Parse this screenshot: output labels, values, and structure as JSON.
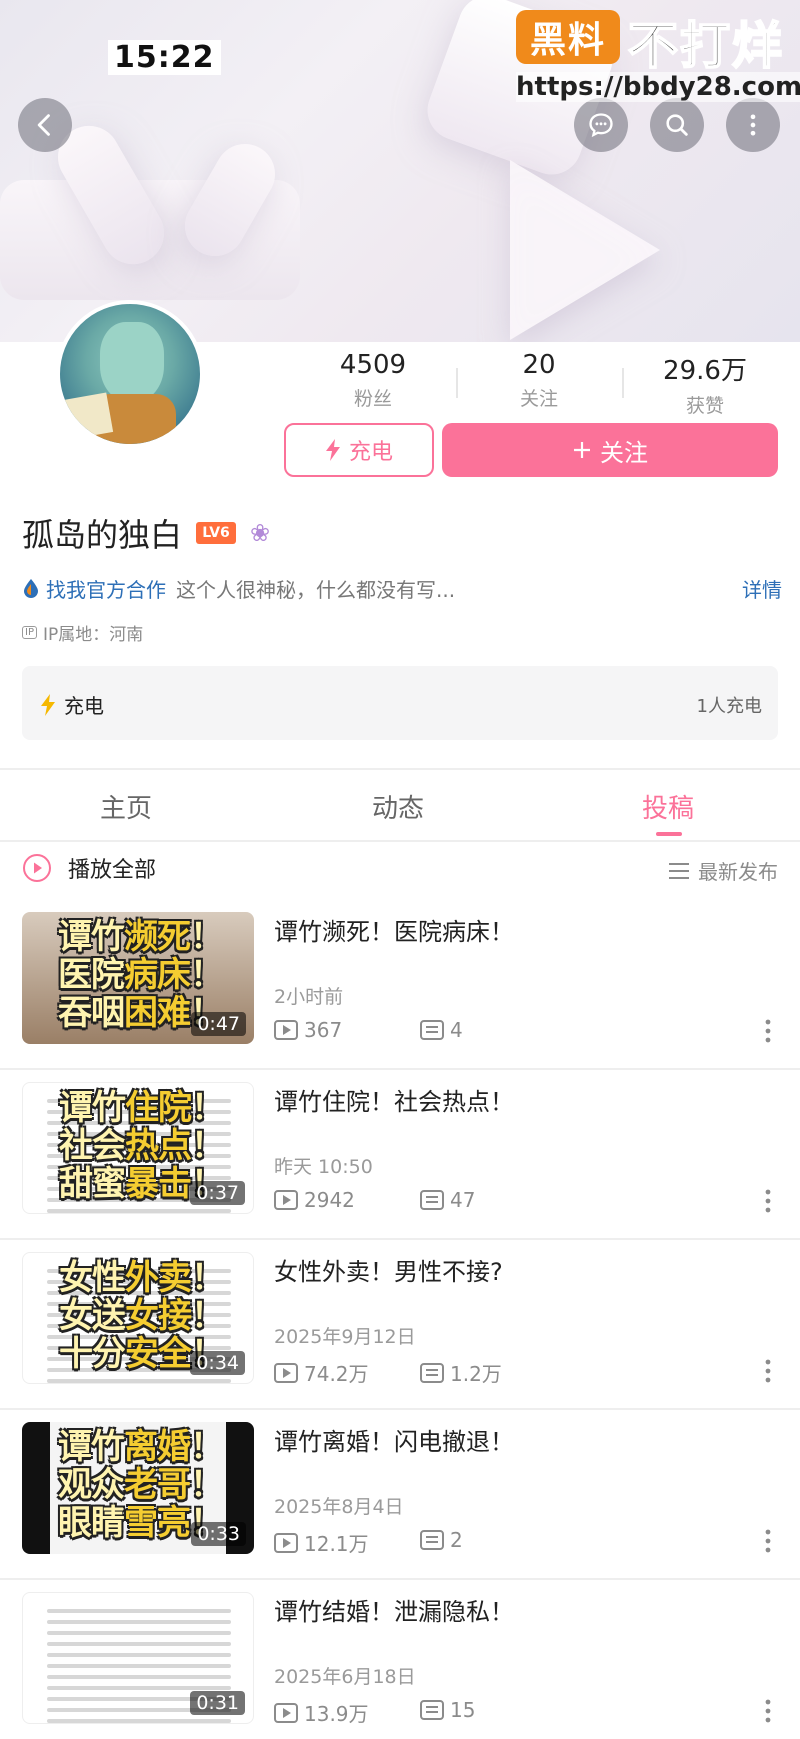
{
  "status": {
    "time": "15:22"
  },
  "watermark": {
    "logo": "黑料",
    "title": "不打烊",
    "url": "https://bbdy28.com"
  },
  "header": {
    "icons": [
      "chevron-left-icon",
      "message-icon",
      "search-icon",
      "more-vertical-icon"
    ]
  },
  "profile": {
    "stats": [
      {
        "value": "4509",
        "label": "粉丝"
      },
      {
        "value": "20",
        "label": "关注"
      },
      {
        "value": "29.6万",
        "label": "获赞"
      }
    ],
    "charge_button": "充电",
    "follow_button": "关注",
    "username": "孤岛的独白",
    "level": "LV6",
    "cooperation": "找我官方合作",
    "bio": "这个人很神秘，什么都没有写...",
    "details_link": "详情",
    "ip_badge": "IP",
    "ip_location": "IP属地：河南",
    "charge_card": {
      "label": "充电",
      "count": "1人充电"
    }
  },
  "tabs": [
    {
      "label": "主页",
      "active": false
    },
    {
      "label": "动态",
      "active": false
    },
    {
      "label": "投稿",
      "active": true
    }
  ],
  "list_header": {
    "play_all": "播放全部",
    "sort": "最新发布"
  },
  "videos": [
    {
      "cover": [
        "谭竹",
        "濒死",
        "！",
        "医院",
        "病床",
        "！",
        "吞咽",
        "困难",
        "！"
      ],
      "duration": "0:47",
      "title": "谭竹濒死！医院病床！",
      "date": "2小时前",
      "plays": "367",
      "comments": "4"
    },
    {
      "cover": [
        "谭竹",
        "住院",
        "！",
        "社会",
        "热点",
        "！",
        "甜蜜",
        "暴击",
        "！"
      ],
      "duration": "0:37",
      "title": "谭竹住院！社会热点！",
      "date": "昨天 10:50",
      "plays": "2942",
      "comments": "47"
    },
    {
      "cover": [
        "女性",
        "外卖",
        "！",
        "女送",
        "女接",
        "！",
        "十分",
        "安全",
        "！"
      ],
      "duration": "0:34",
      "title": "女性外卖！男性不接?",
      "date": "2025年9月12日",
      "plays": "74.2万",
      "comments": "1.2万"
    },
    {
      "cover": [
        "谭竹",
        "离婚",
        "！",
        "观众",
        "老哥",
        "！",
        "眼睛",
        "雪亮",
        "！"
      ],
      "duration": "0:33",
      "title": "谭竹离婚！闪电撤退！",
      "date": "2025年8月4日",
      "plays": "12.1万",
      "comments": "2"
    },
    {
      "cover": [],
      "duration": "0:31",
      "title": "谭竹结婚！泄漏隐私！",
      "date": "2025年6月18日",
      "plays": "13.9万",
      "comments": "15"
    }
  ],
  "colors": {
    "accent": "#fb7299",
    "link": "#2d6fb7",
    "watermark_orange": "#f08a1b"
  }
}
